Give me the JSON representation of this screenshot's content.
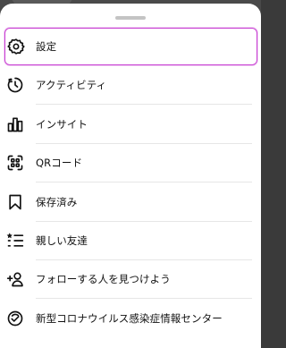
{
  "menu": {
    "items": [
      {
        "label": "設定",
        "icon": "settings-gear-icon"
      },
      {
        "label": "アクティビティ",
        "icon": "activity-clock-icon"
      },
      {
        "label": "インサイト",
        "icon": "insights-bar-chart-icon"
      },
      {
        "label": "QRコード",
        "icon": "qr-code-icon"
      },
      {
        "label": "保存済み",
        "icon": "bookmark-icon"
      },
      {
        "label": "親しい友達",
        "icon": "close-friends-list-icon"
      },
      {
        "label": "フォローする人を見つけよう",
        "icon": "add-person-icon"
      },
      {
        "label": "新型コロナウイルス感染症情報センター",
        "icon": "covid-info-icon"
      }
    ]
  },
  "colors": {
    "selection_border": "#c83fd2",
    "text": "#111111",
    "divider": "#e6e6e6"
  }
}
